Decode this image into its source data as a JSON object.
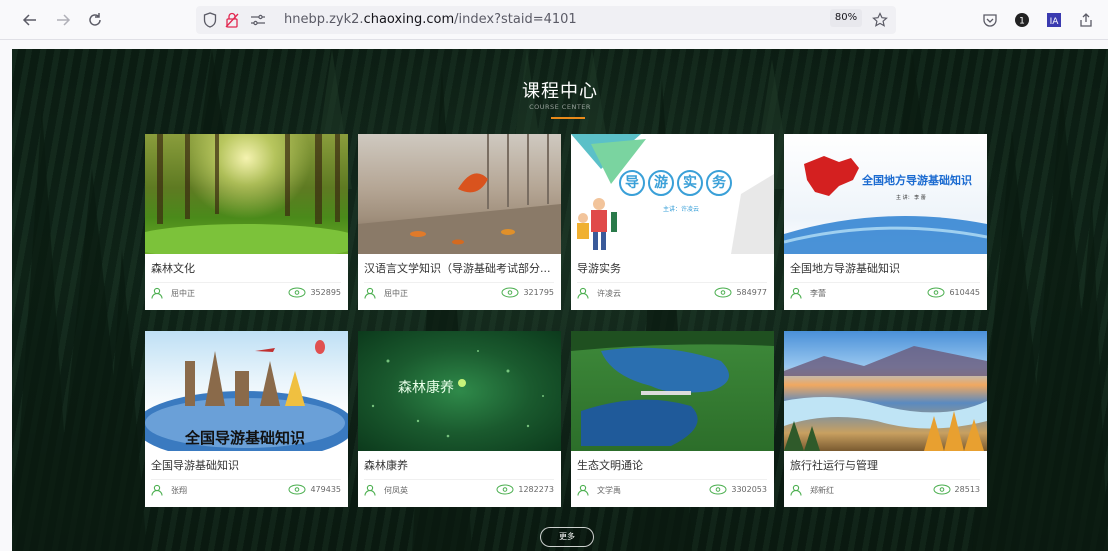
{
  "browser": {
    "url_prefix": "hnebp.zyk2.",
    "url_domain": "chaoxing.com",
    "url_path": "/index?staid=4101",
    "zoom": "80%"
  },
  "section": {
    "title": "课程中心",
    "subtitle": "COURSE CENTER",
    "more_label": "更多"
  },
  "courses": [
    {
      "title": "森林文化",
      "author": "屈中正",
      "views": "352895"
    },
    {
      "title": "汉语言文学知识（导游基础考试部分...",
      "author": "屈中正",
      "views": "321795"
    },
    {
      "title": "导游实务",
      "author": "许凌云",
      "views": "584977",
      "cover_chars": [
        "导",
        "游",
        "实",
        "务"
      ],
      "cover_sub": "主讲：许凌云"
    },
    {
      "title": "全国地方导游基础知识",
      "author": "李蕾",
      "views": "610445",
      "cover_title": "全国地方导游基础知识",
      "cover_sub": "主 讲： 李 蕾"
    },
    {
      "title": "全国导游基础知识",
      "author": "张翔",
      "views": "479435",
      "cover_title": "全国导游基础知识"
    },
    {
      "title": "森林康养",
      "author": "何凤英",
      "views": "1282273",
      "cover_title": "森林康养"
    },
    {
      "title": "生态文明通论",
      "author": "文学禹",
      "views": "3302053"
    },
    {
      "title": "旅行社运行与管理",
      "author": "郑新红",
      "views": "28513"
    }
  ],
  "colors": {
    "accent": "#e88a1a",
    "icon_green": "#4caf50"
  }
}
